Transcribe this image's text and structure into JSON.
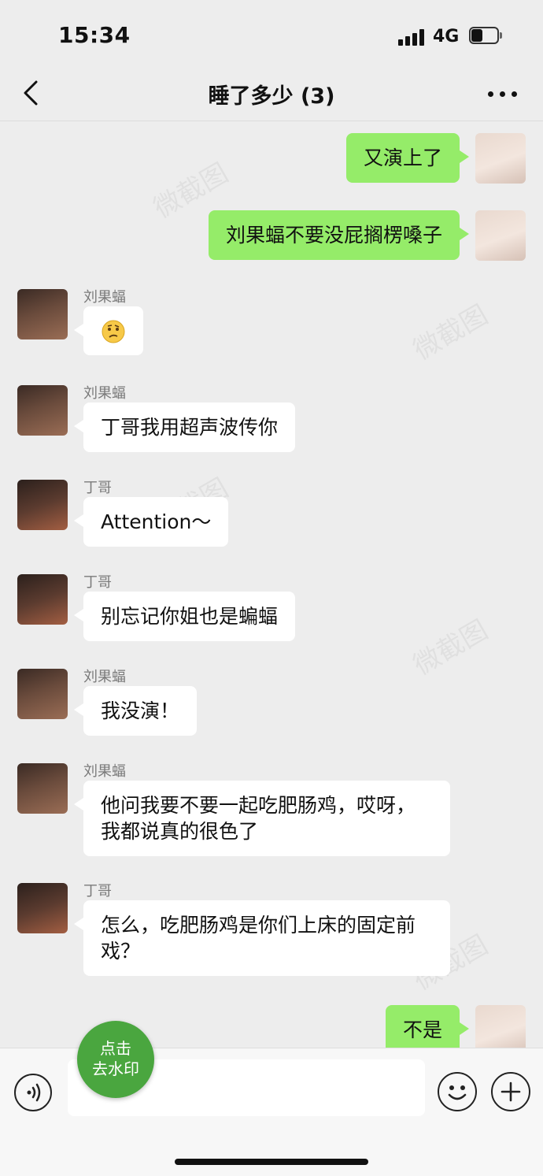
{
  "status": {
    "time": "15:34",
    "network": "4G"
  },
  "nav": {
    "title": "睡了多少 (3)"
  },
  "messages": [
    {
      "side": "out",
      "text": "又演上了"
    },
    {
      "side": "out",
      "text": "刘果蝠不要没屁搁楞嗓子"
    },
    {
      "side": "in",
      "sender": "刘果蝠",
      "emoji": "confused-face-emoji"
    },
    {
      "side": "in",
      "sender": "刘果蝠",
      "text": "丁哥我用超声波传你"
    },
    {
      "side": "in",
      "sender": "丁哥",
      "text": "Attention～"
    },
    {
      "side": "in",
      "sender": "丁哥",
      "text": "别忘记你姐也是蝙蝠"
    },
    {
      "side": "in",
      "sender": "刘果蝠",
      "text": "我没演！"
    },
    {
      "side": "in",
      "sender": "刘果蝠",
      "text": "他问我要不要一起吃肥肠鸡，哎呀，我都说真的很色了"
    },
    {
      "side": "in",
      "sender": "丁哥",
      "text": "怎么，吃肥肠鸡是你们上床的固定前戏？"
    },
    {
      "side": "out",
      "text": "不是"
    }
  ],
  "watermark": {
    "text": "微截图",
    "button_line1": "点击",
    "button_line2": "去水印"
  },
  "colors": {
    "outgoing_bubble": "#95ec69",
    "incoming_bubble": "#ffffff",
    "background": "#ededed",
    "watermark_button": "#4aa63f"
  }
}
